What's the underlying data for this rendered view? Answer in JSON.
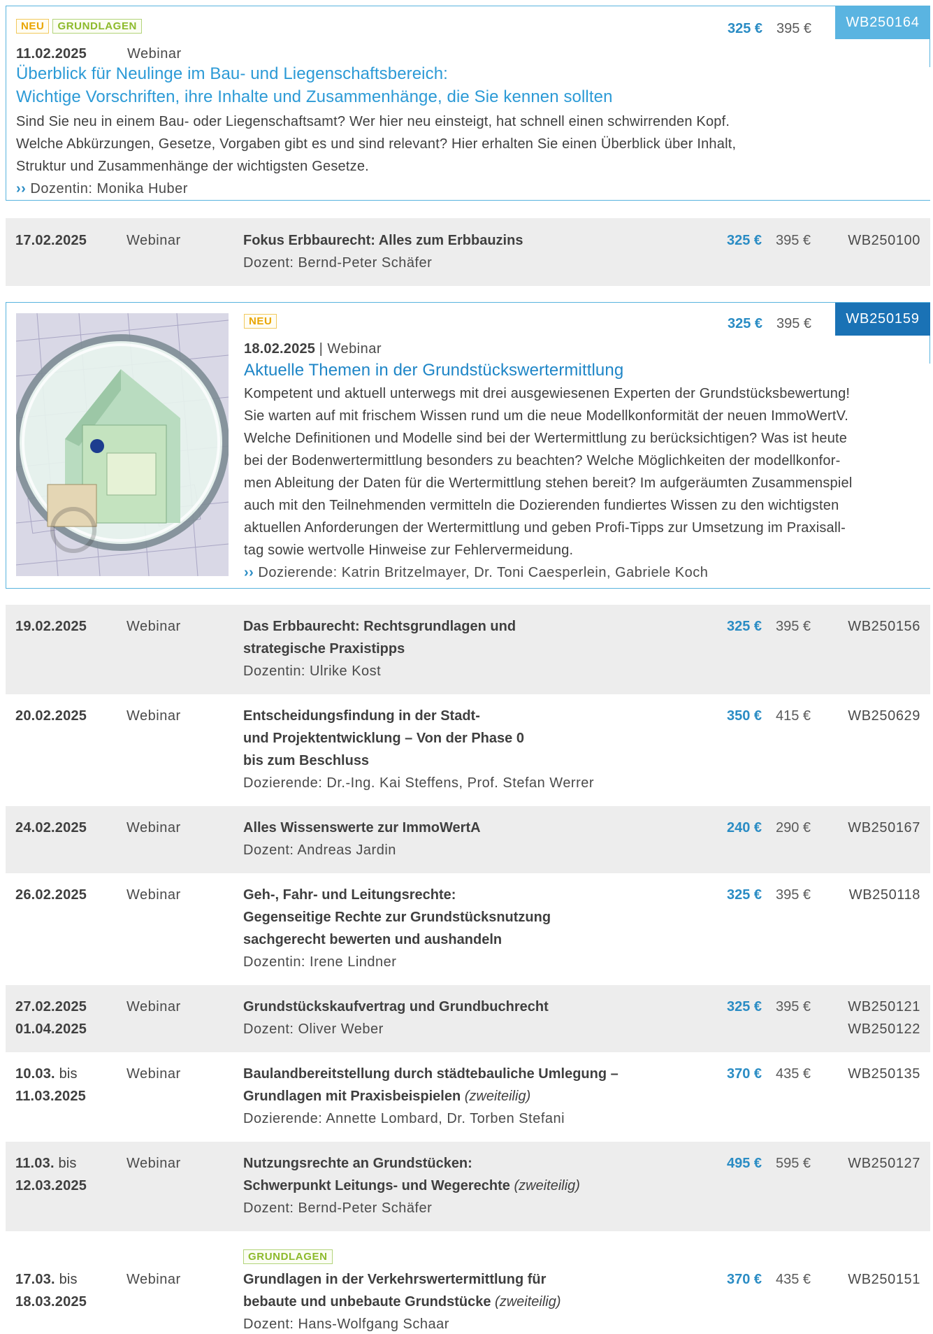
{
  "featured1": {
    "badges": [
      "NEU",
      "GRUNDLAGEN"
    ],
    "date": "11.02.2025",
    "type": "Webinar",
    "title_line1": "Überblick für Neulinge im Bau- und Liegenschaftsbereich:",
    "title_line2": "Wichtige Vorschriften, ihre Inhalte und Zusammenhänge, die Sie kennen sollten",
    "desc_lines": [
      "Sind Sie neu in einem Bau- oder Liegenschaftsamt? Wer hier neu einsteigt, hat schnell einen schwirrenden Kopf.",
      "Welche Abkürzungen, Gesetze, Vorgaben gibt es und sind relevant? Hier erhalten Sie einen Überblick über Inhalt,",
      "Struktur und Zusammenhänge der wichtigsten Gesetze."
    ],
    "speaker": "Dozentin: Monika Huber",
    "price": "325 €",
    "old_price": "395 €",
    "code": "WB250164"
  },
  "row1": {
    "date": "17.02.2025",
    "type": "Webinar",
    "title": "Fokus Erbbaurecht: Alles zum Erbbauzins",
    "speaker": "Dozent: Bernd-Peter Schäfer",
    "price": "325 €",
    "old_price": "395 €",
    "code": "WB250100"
  },
  "featured2": {
    "badge": "NEU",
    "date": "18.02.2025",
    "type_sep": "| Webinar",
    "title": "Aktuelle Themen in der Grundstückswertermittlung",
    "desc_lines": [
      "Kompetent und aktuell unterwegs mit drei ausgewiesenen Experten der Grundstücksbewertung!",
      "Sie warten auf mit frischem Wissen rund um die neue Modellkonformität der neuen ImmoWertV.",
      "Welche Definitionen und Modelle sind bei der Wertermittlung zu berücksichtigen? Was ist heute",
      "bei der Bodenwertermittlung besonders zu beachten? Welche Möglichkeiten der modellkonfor-",
      "men Ableitung der Daten für die Wertermittlung stehen bereit? Im aufgeräumten Zusammenspiel",
      "auch mit den Teilnehmenden vermitteln die Dozierenden fundiertes Wissen zu den wichtigsten",
      "aktuellen Anforderungen der Wertermittlung und geben Profi-Tipps zur Umsetzung im Praxisall-",
      "tag sowie wertvolle Hinweise zur Fehlervermeidung."
    ],
    "speaker": "Dozierende: Katrin Britzelmayer, Dr. Toni Caesperlein, Gabriele Koch",
    "price": "325 €",
    "old_price": "395 €",
    "code": "WB250159"
  },
  "row2": {
    "date": "19.02.2025",
    "type": "Webinar",
    "title_lines": [
      "Das Erbbaurecht: Rechtsgrundlagen und",
      "strategische Praxistipps"
    ],
    "speaker": "Dozentin: Ulrike Kost",
    "price": "325 €",
    "old_price": "395 €",
    "code": "WB250156"
  },
  "row3": {
    "date": "20.02.2025",
    "type": "Webinar",
    "title_lines": [
      "Entscheidungsfindung in der Stadt-",
      "und Projektentwicklung – Von der Phase 0",
      "bis zum Beschluss"
    ],
    "speaker": "Dozierende: Dr.-Ing. Kai Steffens, Prof. Stefan Werrer",
    "price": "350 €",
    "old_price": "415 €",
    "code": "WB250629"
  },
  "row4": {
    "date": "24.02.2025",
    "type": "Webinar",
    "title": "Alles Wissenswerte zur ImmoWertA",
    "speaker": "Dozent: Andreas Jardin",
    "price": "240 €",
    "old_price": "290 €",
    "code": "WB250167"
  },
  "row5": {
    "date": "26.02.2025",
    "type": "Webinar",
    "title_lines": [
      "Geh-, Fahr- und Leitungsrechte:",
      "Gegenseitige Rechte zur Grundstücksnutzung",
      "sachgerecht bewerten und aushandeln"
    ],
    "speaker": "Dozentin: Irene Lindner",
    "price": "325 €",
    "old_price": "395 €",
    "code": "WB250118"
  },
  "row6": {
    "date1": "27.02.2025",
    "date2": "01.04.2025",
    "type": "Webinar",
    "title": "Grundstückskaufvertrag und Grundbuchrecht",
    "speaker": "Dozent: Oliver Weber",
    "price": "325 €",
    "old_price": "395 €",
    "code1": "WB250121",
    "code2": "WB250122"
  },
  "row7": {
    "date_start": "10.03.",
    "bis": "bis",
    "date_end": "11.03.2025",
    "type": "Webinar",
    "title_line1": "Baulandbereitstellung durch städtebauliche Umlegung –",
    "title_line2": "Grundlagen mit Praxisbeispielen",
    "title_note": "(zweiteilig)",
    "speaker": "Dozierende: Annette Lombard, Dr. Torben Stefani",
    "price": "370 €",
    "old_price": "435 €",
    "code": "WB250135"
  },
  "row8": {
    "date_start": "11.03.",
    "bis": "bis",
    "date_end": "12.03.2025",
    "type": "Webinar",
    "title_line1": "Nutzungsrechte an Grundstücken:",
    "title_line2": "Schwerpunkt Leitungs- und Wegerechte",
    "title_note": "(zweiteilig)",
    "speaker": "Dozent: Bernd-Peter Schäfer",
    "price": "495 €",
    "old_price": "595 €",
    "code": "WB250127"
  },
  "row9": {
    "badge": "GRUNDLAGEN",
    "date_start": "17.03.",
    "bis": "bis",
    "date_end": "18.03.2025",
    "type": "Webinar",
    "title_line1": "Grundlagen in der Verkehrswertermittlung für",
    "title_line2": "bebaute und unbebaute Grundstücke",
    "title_note": "(zweiteilig)",
    "speaker": "Dozent: Hans-Wolfgang Schaar",
    "price": "370 €",
    "old_price": "435 €",
    "code": "WB250151"
  },
  "arrow_glyph": "››",
  "colors": {
    "accent": "#2a8cc4",
    "code_light": "#5ab4e1",
    "code_dark": "#1a72b5",
    "row_bg": "#ededed"
  }
}
